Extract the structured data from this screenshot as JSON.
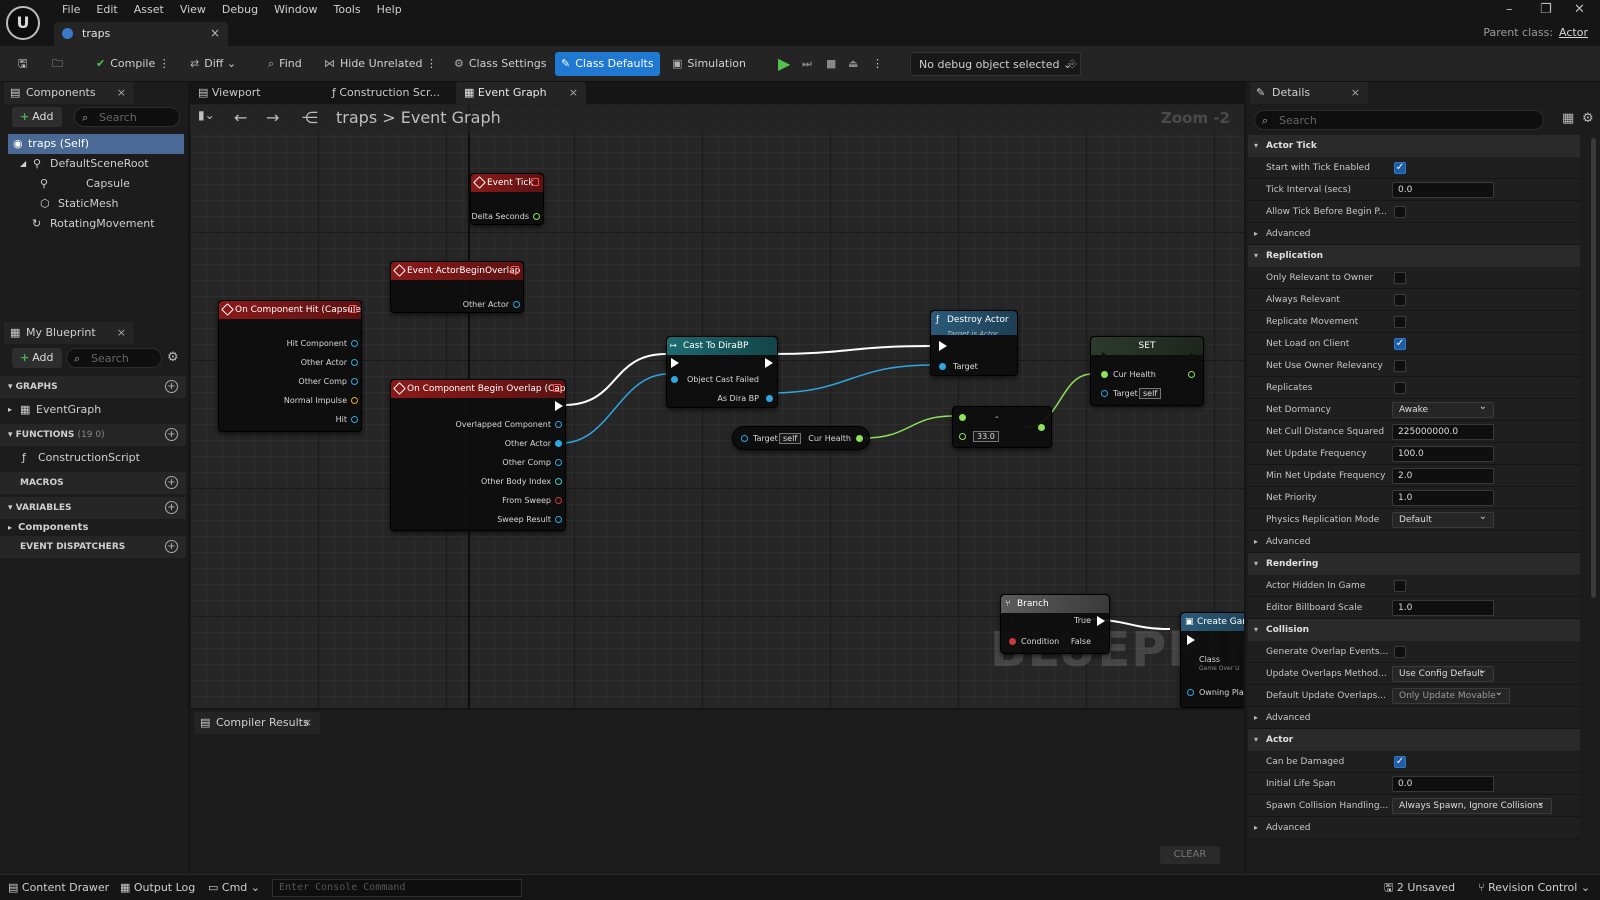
{
  "menu": [
    "File",
    "Edit",
    "Asset",
    "View",
    "Debug",
    "Window",
    "Tools",
    "Help"
  ],
  "doc_tab": "traps",
  "parent_class": {
    "label": "Parent class:",
    "value": "Actor"
  },
  "toolbar": {
    "compile": "Compile",
    "diff": "Diff",
    "find": "Find",
    "hide_unrelated": "Hide Unrelated",
    "class_settings": "Class Settings",
    "class_defaults": "Class Defaults",
    "simulation": "Simulation",
    "debug_object": "No debug object selected"
  },
  "components": {
    "title": "Components",
    "add": "Add",
    "search_placeholder": "Search",
    "items": [
      "traps (Self)",
      "DefaultSceneRoot",
      "Capsule",
      "StaticMesh",
      "RotatingMovement"
    ]
  },
  "my_blueprint": {
    "title": "My Blueprint",
    "add": "Add",
    "search_placeholder": "Search",
    "graphs": "GRAPHS",
    "event_graph": "EventGraph",
    "functions": "FUNCTIONS",
    "functions_count": "(19 0)",
    "construction_script": "ConstructionScript",
    "macros": "MACROS",
    "variables": "VARIABLES",
    "var_components": "Components",
    "event_dispatchers": "EVENT DISPATCHERS"
  },
  "graph_tabs": [
    "Viewport",
    "Construction Scr...",
    "Event Graph"
  ],
  "breadcrumb": {
    "root": "traps",
    "current": "Event Graph"
  },
  "zoom": "Zoom -2",
  "watermark": "BLUEPRINT",
  "nodes": {
    "event_tick": {
      "title": "Event Tick",
      "pins": [
        "Delta Seconds"
      ]
    },
    "actor_begin_overlap": {
      "title": "Event ActorBeginOverlap",
      "pins": [
        "Other Actor"
      ]
    },
    "component_hit": {
      "title": "On Component Hit (Capsule)",
      "pins": [
        "Hit Component",
        "Other Actor",
        "Other Comp",
        "Normal Impulse",
        "Hit"
      ]
    },
    "component_begin_overlap": {
      "title": "On Component Begin Overlap (Capsule)",
      "pins": [
        "Overlapped Component",
        "Other Actor",
        "Other Comp",
        "Other Body Index",
        "From Sweep",
        "Sweep Result"
      ]
    },
    "cast": {
      "title": "Cast To DiraBP",
      "pins": [
        "Object",
        "Cast Failed",
        "As Dira BP"
      ]
    },
    "destroy": {
      "title": "Destroy Actor",
      "subtitle": "Target is Actor",
      "pins": [
        "Target"
      ]
    },
    "get_health": {
      "target": "Target",
      "self": "self",
      "out": "Cur Health"
    },
    "subtract": {
      "symbol": "-",
      "value": "33.0"
    },
    "set": {
      "title": "SET",
      "pins": [
        "Cur Health",
        "Target"
      ],
      "self": "self"
    },
    "branch": {
      "title": "Branch",
      "pins": [
        "Condition",
        "True",
        "False"
      ]
    },
    "create": {
      "title": "Create Game",
      "pins": [
        "Class",
        "Owning Playe"
      ],
      "sub": "Game Over U"
    }
  },
  "compiler": {
    "title": "Compiler Results",
    "clear": "CLEAR"
  },
  "details": {
    "title": "Details",
    "search_placeholder": "Search",
    "categories": {
      "actor_tick": "Actor Tick",
      "replication": "Replication",
      "rendering": "Rendering",
      "collision": "Collision",
      "actor": "Actor"
    },
    "advanced": "Advanced",
    "props": {
      "start_with_tick": "Start with Tick Enabled",
      "tick_interval": "Tick Interval (secs)",
      "tick_interval_val": "0.0",
      "allow_tick": "Allow Tick Before Begin P...",
      "only_relevant": "Only Relevant to Owner",
      "always_relevant": "Always Relevant",
      "replicate_movement": "Replicate Movement",
      "net_load": "Net Load on Client",
      "net_use_owner": "Net Use Owner Relevancy",
      "replicates": "Replicates",
      "net_dormancy": "Net Dormancy",
      "net_dormancy_val": "Awake",
      "net_cull": "Net Cull Distance Squared",
      "net_cull_val": "225000000.0",
      "net_update": "Net Update Frequency",
      "net_update_val": "100.0",
      "min_net_update": "Min Net Update Frequency",
      "min_net_update_val": "2.0",
      "net_priority": "Net Priority",
      "net_priority_val": "1.0",
      "phys_rep": "Physics Replication Mode",
      "phys_rep_val": "Default",
      "hidden_in_game": "Actor Hidden In Game",
      "billboard": "Editor Billboard Scale",
      "billboard_val": "1.0",
      "gen_overlap": "Generate Overlap Events...",
      "update_overlaps": "Update Overlaps Method...",
      "update_overlaps_val": "Use Config Default",
      "default_update": "Default Update Overlaps...",
      "default_update_val": "Only Update Movable",
      "can_be_damaged": "Can be Damaged",
      "life_span": "Initial Life Span",
      "life_span_val": "0.0",
      "spawn_collision": "Spawn Collision Handling...",
      "spawn_collision_val": "Always Spawn, Ignore Collisions"
    }
  },
  "status": {
    "content_drawer": "Content Drawer",
    "output_log": "Output Log",
    "cmd": "Cmd",
    "console_placeholder": "Enter Console Command",
    "unsaved": "2 Unsaved",
    "revision": "Revision Control"
  }
}
